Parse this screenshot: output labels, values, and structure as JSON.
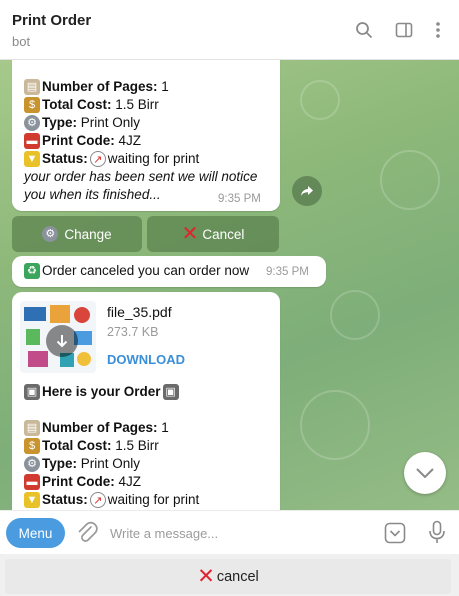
{
  "header": {
    "title": "Print Order",
    "subtitle": "bot",
    "icons": [
      "search-icon",
      "sidebar-toggle-icon",
      "more-vertical-icon"
    ]
  },
  "order_message_top": {
    "pages_label": "Number of Pages:",
    "pages_value": "1",
    "cost_label": "Total Cost:",
    "cost_value": "1.5 Birr",
    "type_label": "Type:",
    "type_value": "Print Only",
    "code_label": "Print Code:",
    "code_value": "4JZ",
    "status_label": "Status:",
    "status_value": "waiting for print",
    "notice_line1": "your order has been sent we will notice",
    "notice_line2": "you when its finished...",
    "time": "9:35 PM"
  },
  "inline_keyboard": {
    "change_label": "Change",
    "cancel_label": "Cancel"
  },
  "cancel_message": {
    "text": "Order canceled you can order now",
    "time": "9:35 PM"
  },
  "file_message": {
    "file_name": "file_35.pdf",
    "file_size": "273.7 KB",
    "download_label": "DOWNLOAD",
    "heading": "Here is your Order",
    "pages_label": "Number of Pages:",
    "pages_value": "1",
    "cost_label": "Total Cost:",
    "cost_value": "1.5 Birr",
    "type_label": "Type:",
    "type_value": "Print Only",
    "code_label": "Print Code:",
    "code_value": "4JZ",
    "status_label": "Status:",
    "status_value": "waiting for print"
  },
  "composer": {
    "menu_label": "Menu",
    "placeholder": "Write a message..."
  },
  "reply_keyboard": {
    "cancel_label": "cancel"
  },
  "colors": {
    "accent": "#4a9be0",
    "cancel_x": "#e0232e",
    "chat_bg": "#8db87a"
  }
}
